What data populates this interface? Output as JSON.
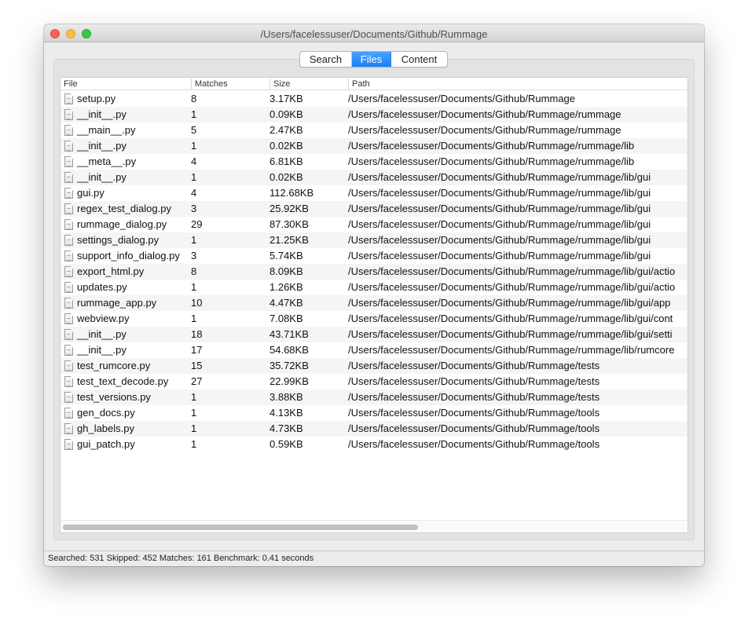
{
  "window": {
    "title": "/Users/facelessuser/Documents/Github/Rummage"
  },
  "tabs": [
    {
      "label": "Search",
      "selected": false
    },
    {
      "label": "Files",
      "selected": true
    },
    {
      "label": "Content",
      "selected": false
    }
  ],
  "accent_color": "#1a7ff7",
  "table": {
    "columns": [
      "File",
      "Matches",
      "Size",
      "Path"
    ],
    "rows": [
      [
        "setup.py",
        "8",
        "3.17KB",
        "/Users/facelessuser/Documents/Github/Rummage"
      ],
      [
        "__init__.py",
        "1",
        "0.09KB",
        "/Users/facelessuser/Documents/Github/Rummage/rummage"
      ],
      [
        "__main__.py",
        "5",
        "2.47KB",
        "/Users/facelessuser/Documents/Github/Rummage/rummage"
      ],
      [
        "__init__.py",
        "1",
        "0.02KB",
        "/Users/facelessuser/Documents/Github/Rummage/rummage/lib"
      ],
      [
        "__meta__.py",
        "4",
        "6.81KB",
        "/Users/facelessuser/Documents/Github/Rummage/rummage/lib"
      ],
      [
        "__init__.py",
        "1",
        "0.02KB",
        "/Users/facelessuser/Documents/Github/Rummage/rummage/lib/gui"
      ],
      [
        "gui.py",
        "4",
        "112.68KB",
        "/Users/facelessuser/Documents/Github/Rummage/rummage/lib/gui"
      ],
      [
        "regex_test_dialog.py",
        "3",
        "25.92KB",
        "/Users/facelessuser/Documents/Github/Rummage/rummage/lib/gui"
      ],
      [
        "rummage_dialog.py",
        "29",
        "87.30KB",
        "/Users/facelessuser/Documents/Github/Rummage/rummage/lib/gui"
      ],
      [
        "settings_dialog.py",
        "1",
        "21.25KB",
        "/Users/facelessuser/Documents/Github/Rummage/rummage/lib/gui"
      ],
      [
        "support_info_dialog.py",
        "3",
        "5.74KB",
        "/Users/facelessuser/Documents/Github/Rummage/rummage/lib/gui"
      ],
      [
        "export_html.py",
        "8",
        "8.09KB",
        "/Users/facelessuser/Documents/Github/Rummage/rummage/lib/gui/actio"
      ],
      [
        "updates.py",
        "1",
        "1.26KB",
        "/Users/facelessuser/Documents/Github/Rummage/rummage/lib/gui/actio"
      ],
      [
        "rummage_app.py",
        "10",
        "4.47KB",
        "/Users/facelessuser/Documents/Github/Rummage/rummage/lib/gui/app"
      ],
      [
        "webview.py",
        "1",
        "7.08KB",
        "/Users/facelessuser/Documents/Github/Rummage/rummage/lib/gui/cont"
      ],
      [
        "__init__.py",
        "18",
        "43.71KB",
        "/Users/facelessuser/Documents/Github/Rummage/rummage/lib/gui/setti"
      ],
      [
        "__init__.py",
        "17",
        "54.68KB",
        "/Users/facelessuser/Documents/Github/Rummage/rummage/lib/rumcore"
      ],
      [
        "test_rumcore.py",
        "15",
        "35.72KB",
        "/Users/facelessuser/Documents/Github/Rummage/tests"
      ],
      [
        "test_text_decode.py",
        "27",
        "22.99KB",
        "/Users/facelessuser/Documents/Github/Rummage/tests"
      ],
      [
        "test_versions.py",
        "1",
        "3.88KB",
        "/Users/facelessuser/Documents/Github/Rummage/tests"
      ],
      [
        "gen_docs.py",
        "1",
        "4.13KB",
        "/Users/facelessuser/Documents/Github/Rummage/tools"
      ],
      [
        "gh_labels.py",
        "1",
        "4.73KB",
        "/Users/facelessuser/Documents/Github/Rummage/tools"
      ],
      [
        "gui_patch.py",
        "1",
        "0.59KB",
        "/Users/facelessuser/Documents/Github/Rummage/tools"
      ]
    ]
  },
  "statusbar": {
    "text": "Searched: 531 Skipped: 452 Matches: 161 Benchmark: 0.41 seconds"
  }
}
